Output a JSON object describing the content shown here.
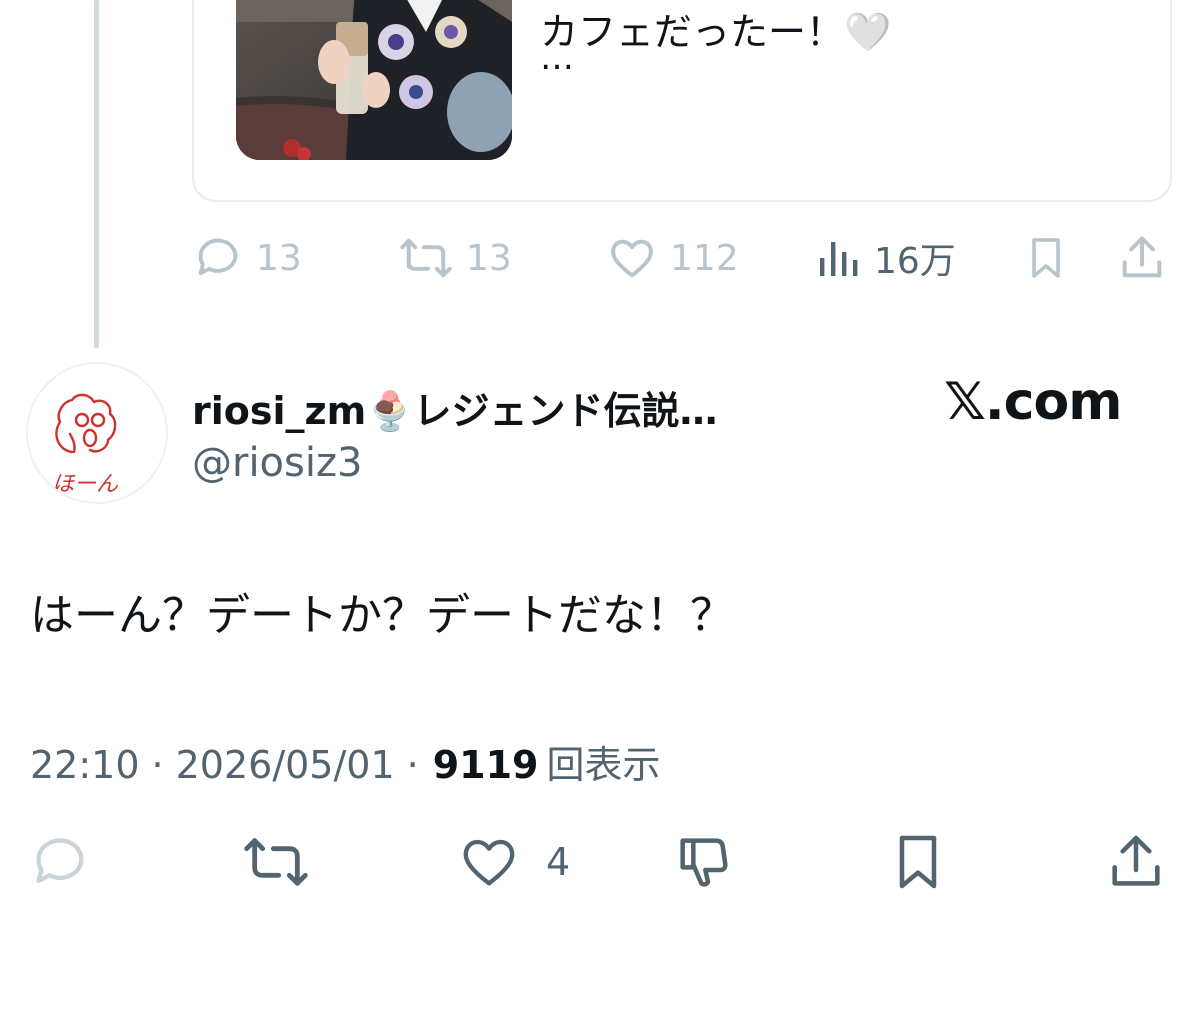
{
  "quoted_tweet": {
    "text": "カフェだったー！🤍",
    "more": "…",
    "stats": {
      "replies": "13",
      "retweets": "13",
      "likes": "112",
      "views": "16万"
    }
  },
  "tweet": {
    "display_name": "riosi_zm🍨レジェンド伝説…",
    "handle": "@riosiz3",
    "avatar_label": "ほーん",
    "text": "はーん？デートか？デートだな！？",
    "time": "22:10",
    "date": "2026/05/01",
    "views_count": "9119",
    "views_suffix": "回表示",
    "likes": "4"
  },
  "brand": "𝕏.com",
  "colors": {
    "text": "#0f1419",
    "muted": "#536471",
    "faded": "#b8c4cc",
    "avatar_ink": "#d0312d"
  }
}
